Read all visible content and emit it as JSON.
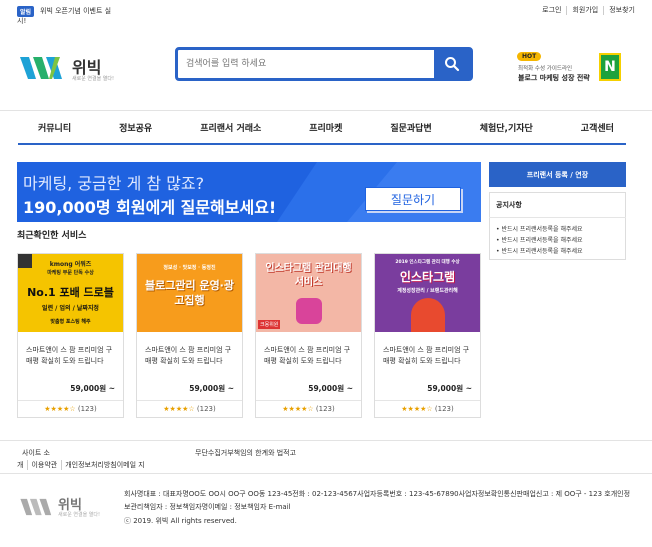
{
  "topbar": {
    "badge": "알림",
    "notice_line1": "위빅 오픈기념 이벤트 실",
    "notice_line2": "시!",
    "links": [
      "로그인",
      "회원가입",
      "정보찾기"
    ]
  },
  "header": {
    "logo_text": "위빅",
    "logo_sub": "새로운 연결을 열다!",
    "search_placeholder": "검색어를 입력 하세요",
    "search_icon": "search-icon",
    "ad_badge": "HOT",
    "ad_sub": "최적화 수성 가이드라인",
    "ad_title": "블로그 마케팅 성장 전략",
    "ad_icon_letter": "N"
  },
  "nav": [
    "커뮤니티",
    "정보공유",
    "프리랜서 거래소",
    "프리마켓",
    "질문과답변",
    "체험단,기자단",
    "고객센터"
  ],
  "banner": {
    "line1": "마케팅, 궁금한 게 참 많죠?",
    "line2": "190,000명 회원에게 질문해보세요!",
    "button": "질문하기"
  },
  "sidebar": {
    "button": "프리랜서 등록 / 연장",
    "notice_title": "공지사항",
    "notice_items": [
      "반드시 프리랜서등록을 해주세요",
      "반드시 프리랜서등록을 해주세요",
      "반드시 프리랜서등록을 해주세요"
    ]
  },
  "recent": {
    "title": "최근확인한 서비스",
    "cards": [
      {
        "img_top": "kmong 어워즈",
        "img_sub": "마케팅 부문 단독 수상",
        "img_main": "No.1 포배 드로블",
        "img_sub2": "일련 / 업의 / 날짜지정",
        "img_tag": "맞춤형 포스팅 해주",
        "desc": "스마트앤이 스 팜 프리미엄 구매평 확실히 도와 드립니다",
        "price": "59,000원 ~",
        "stars": "★★★★☆",
        "rating": "(123)",
        "bg": "#f5c400"
      },
      {
        "img_top": "정보성 · 맛보정 · 등정진",
        "img_main": "블로그관리 운영·광고집행",
        "desc": "스마트앤이 스 팜 프리미엄 구매평 확실히 도와 드립니다",
        "price": "59,000원 ~",
        "stars": "★★★★☆",
        "rating": "(123)",
        "bg": "#f79c1c"
      },
      {
        "img_main": "인스타그램 관리대행 서비스",
        "img_tag": "크몽위원",
        "desc": "스마트앤이 스 팜 프리미엄 구매평 확실히 도와 드립니다",
        "price": "59,000원 ~",
        "stars": "★★★★☆",
        "rating": "(123)",
        "bg": "#f3b7a6"
      },
      {
        "img_top": "2019 인스타그램 관리 대행 수상",
        "img_main": "인스타그램",
        "img_sub": "계정성장관리 / 브랜드관리해",
        "desc": "스마트앤이 스 팜 프리미엄 구매평 확실히 도와 드립니다",
        "price": "59,000원 ~",
        "stars": "★★★★☆",
        "rating": "(123)",
        "bg": "#7a3d9e"
      }
    ]
  },
  "footer": {
    "link_1a": "사이트 소",
    "link_1b": "무단수집거부책임의 한계와 법적고",
    "links_row2": [
      "개",
      "이용약관",
      "개인정보처리방침이메일 지"
    ],
    "logo_text": "위빅",
    "logo_sub": "새로운 연결을 열다!",
    "info": "회사명대표 : 대표자명OO도 OO시 OO구 OO동 123-45전화 : 02-123-4567사업자등록번호 : 123-45-67890사업자정보확인통신판매업신고 : 제 OO구 - 123 호개인정보관리책임자 : 정보책임자명이메일 : 정보책임자 E-mail",
    "copyright": "ⓒ 2019. 위빅 All rights reserved."
  }
}
